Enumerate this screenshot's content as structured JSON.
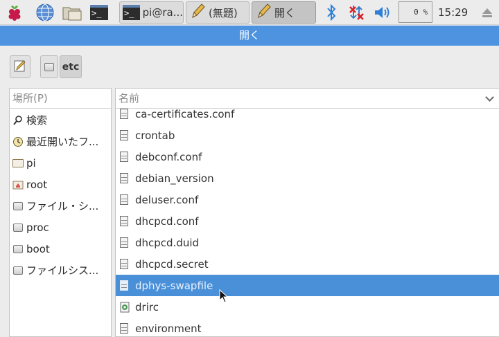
{
  "taskbar": {
    "tasks": [
      {
        "label": "pi@ra...",
        "icon": "terminal-icon"
      },
      {
        "label": "(無題)",
        "icon": "pencil-icon"
      },
      {
        "label": "開く",
        "icon": "pencil-icon"
      }
    ],
    "terminal_glyph": ">_",
    "cpu": "0 %",
    "clock": "15:29"
  },
  "dialog": {
    "title": "開く"
  },
  "pathbar": {
    "current": "etc"
  },
  "places": {
    "header": "場所(P)",
    "items": [
      {
        "label": "検索",
        "icon": "search-icon"
      },
      {
        "label": "最近開いたフ...",
        "icon": "recent-icon"
      },
      {
        "label": "pi",
        "icon": "folder-icon"
      },
      {
        "label": "root",
        "icon": "home-folder-icon"
      },
      {
        "label": "ファイル・シ...",
        "icon": "drive-icon"
      },
      {
        "label": "proc",
        "icon": "drive-icon"
      },
      {
        "label": "boot",
        "icon": "drive-icon"
      },
      {
        "label": "ファイルシス...",
        "icon": "drive-icon"
      }
    ]
  },
  "files": {
    "header": "名前",
    "items": [
      {
        "name": "ca-certificates.conf"
      },
      {
        "name": "crontab"
      },
      {
        "name": "debconf.conf"
      },
      {
        "name": "debian_version"
      },
      {
        "name": "deluser.conf"
      },
      {
        "name": "dhcpcd.conf"
      },
      {
        "name": "dhcpcd.duid"
      },
      {
        "name": "dhcpcd.secret"
      },
      {
        "name": "dphys-swapfile",
        "selected": true
      },
      {
        "name": "drirc"
      },
      {
        "name": "environment"
      }
    ]
  },
  "colors": {
    "accent": "#4d93e0",
    "selection": "#4a90d9",
    "panel_bg": "#ececec"
  }
}
